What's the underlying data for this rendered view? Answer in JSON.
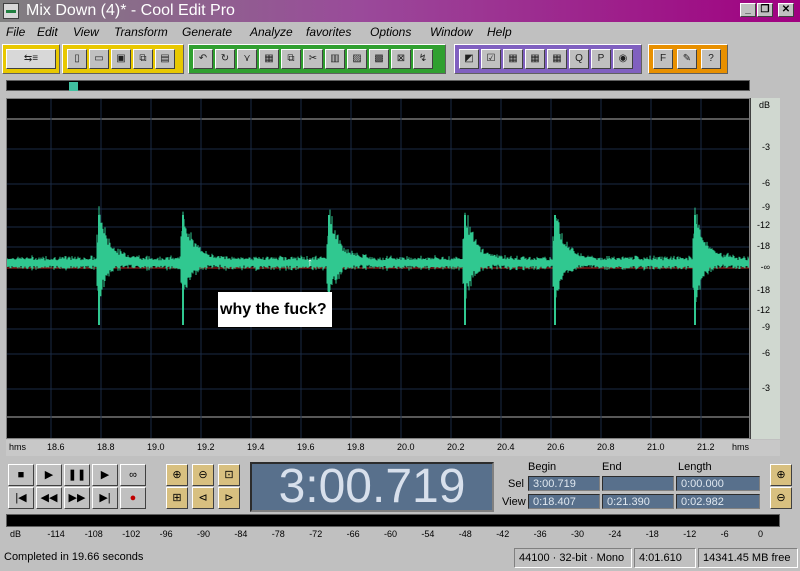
{
  "window": {
    "title": "Mix Down (4)* - Cool Edit Pro",
    "controls": {
      "minimize": "_",
      "restore": "❐",
      "close": "✕"
    }
  },
  "menu": {
    "items": [
      "File",
      "Edit",
      "View",
      "Transform",
      "Generate",
      "Analyze",
      "favorites",
      "Options",
      "Window",
      "Help"
    ]
  },
  "toolbar": {
    "group_colors": [
      "#e8c800",
      "#30a030",
      "#8060c0",
      "#e89000"
    ],
    "icons": [
      "multitrack-icon",
      "new-icon",
      "open-icon",
      "save-icon",
      "save-as-icon",
      "close-file-icon",
      "undo-icon",
      "redo-icon",
      "envelope-icon",
      "grid-icon",
      "copy-icon",
      "cut-icon",
      "paste-icon",
      "paste-new-icon",
      "mix-paste-icon",
      "crop-icon",
      "trim-icon",
      "frequency-icon",
      "marker-icon",
      "cue-icon",
      "mixer-icon",
      "spectral-icon",
      "info-icon",
      "cd-icon",
      "script-icon",
      "favorite-icon",
      "help-icon"
    ]
  },
  "waveform": {
    "wave_color": "#30c890",
    "center_line_color": "#c02020",
    "annotation": "why the fuck?",
    "cursor_glyph": "↑"
  },
  "db_scale": {
    "unit": "dB",
    "labels": [
      "dB",
      "-3",
      "-6",
      "-9",
      "-12",
      "-18",
      "-∞",
      "-18",
      "-12",
      "-9",
      "-6",
      "-3"
    ]
  },
  "time_ruler": {
    "unit": "hms",
    "ticks": [
      "18.6",
      "18.8",
      "19.0",
      "19.2",
      "19.4",
      "19.6",
      "19.8",
      "20.0",
      "20.2",
      "20.4",
      "20.6",
      "20.8",
      "21.0",
      "21.2"
    ]
  },
  "transport": {
    "stop": "■",
    "play": "▶",
    "pause": "❚❚",
    "play_to_end": "▶",
    "loop": "∞",
    "go_start": "|◀",
    "rewind": "◀◀",
    "fast_forward": "▶▶",
    "go_end": "▶|",
    "record": "●"
  },
  "time_display": "3:00.719",
  "selection": {
    "headers": {
      "begin": "Begin",
      "end": "End",
      "length": "Length"
    },
    "sel": {
      "label": "Sel",
      "begin": "3:00.719",
      "end": "",
      "length": "0:00.000"
    },
    "view": {
      "label": "View",
      "begin": "0:18.407",
      "end": "0:21.390",
      "length": "0:02.982"
    }
  },
  "level_meter": {
    "labels": [
      "dB",
      "-114",
      "-108",
      "-102",
      "-96",
      "-90",
      "-84",
      "-78",
      "-72",
      "-66",
      "-60",
      "-54",
      "-48",
      "-42",
      "-36",
      "-30",
      "-24",
      "-18",
      "-12",
      "-6",
      "0"
    ]
  },
  "status": {
    "message": "Completed in 19.66 seconds",
    "format": "44100 · 32-bit · Mono",
    "duration": "4:01.610",
    "free": "14341.45 MB free"
  }
}
